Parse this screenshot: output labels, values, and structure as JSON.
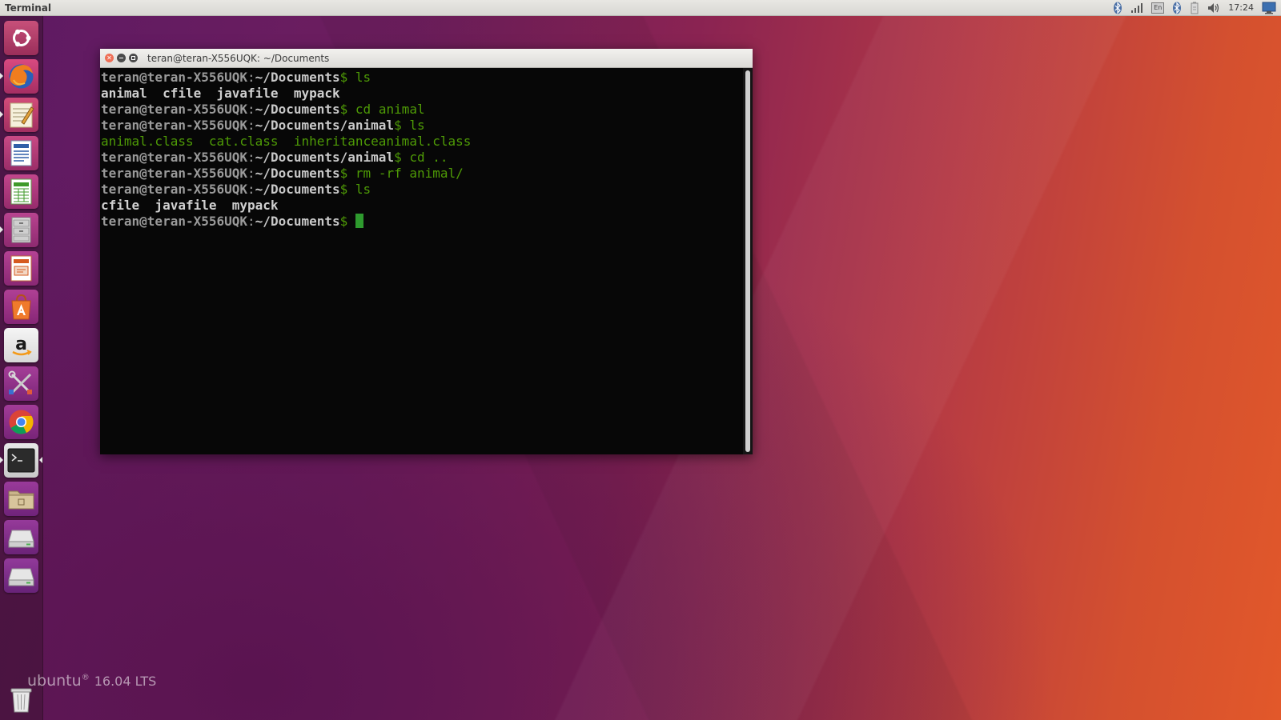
{
  "top_panel": {
    "app_title": "Terminal",
    "keyboard_layout": "En",
    "clock": "17:24",
    "tray_icons": [
      "bluetooth-icon",
      "network-signal-icon",
      "keyboard-layout-icon",
      "bluetooth-icon",
      "battery-icon",
      "volume-icon",
      "clock",
      "system-menu-icon"
    ]
  },
  "launcher": {
    "items": [
      {
        "name": "ubuntu-dash",
        "icon": "ubuntu-logo-icon"
      },
      {
        "name": "firefox",
        "icon": "firefox-icon"
      },
      {
        "name": "text-editor",
        "icon": "text-editor-icon"
      },
      {
        "name": "libreoffice-writer",
        "icon": "writer-document-icon"
      },
      {
        "name": "libreoffice-calc",
        "icon": "calc-spreadsheet-icon"
      },
      {
        "name": "files",
        "icon": "file-cabinet-icon"
      },
      {
        "name": "libreoffice-impress",
        "icon": "impress-presentation-icon"
      },
      {
        "name": "software-center",
        "icon": "shopping-bag-icon"
      },
      {
        "name": "amazon",
        "icon": "amazon-icon"
      },
      {
        "name": "system-settings",
        "icon": "tools-icon"
      },
      {
        "name": "chrome",
        "icon": "chrome-icon"
      },
      {
        "name": "terminal",
        "icon": "terminal-icon"
      },
      {
        "name": "home-folder",
        "icon": "folder-icon"
      },
      {
        "name": "drive-1",
        "icon": "drive-icon"
      },
      {
        "name": "drive-2",
        "icon": "drive-icon"
      },
      {
        "name": "trash",
        "icon": "trash-icon"
      }
    ]
  },
  "branding": {
    "name": "ubuntu",
    "reg": "®",
    "version": "16.04 LTS"
  },
  "terminal": {
    "window_title": "teran@teran-X556UQK: ~/Documents",
    "lines": [
      {
        "user": "teran@teran-X556UQK",
        "colon": ":",
        "path": "~/Documents",
        "dollar": "$",
        "cmd": " ls"
      },
      {
        "out": "animal  cfile  javafile  mypack",
        "style": "plain"
      },
      {
        "user": "teran@teran-X556UQK",
        "colon": ":",
        "path": "~/Documents",
        "dollar": "$",
        "cmd": " cd animal"
      },
      {
        "user": "teran@teran-X556UQK",
        "colon": ":",
        "path": "~/Documents/animal",
        "dollar": "$",
        "cmd": " ls"
      },
      {
        "out": "animal.class  cat.class  inheritanceanimal.class",
        "style": "green"
      },
      {
        "user": "teran@teran-X556UQK",
        "colon": ":",
        "path": "~/Documents/animal",
        "dollar": "$",
        "cmd": " cd .."
      },
      {
        "user": "teran@teran-X556UQK",
        "colon": ":",
        "path": "~/Documents",
        "dollar": "$",
        "cmd": " rm -rf animal/"
      },
      {
        "user": "teran@teran-X556UQK",
        "colon": ":",
        "path": "~/Documents",
        "dollar": "$",
        "cmd": " ls"
      },
      {
        "out": "cfile  javafile  mypack",
        "style": "plain"
      },
      {
        "user": "teran@teran-X556UQK",
        "colon": ":",
        "path": "~/Documents",
        "dollar": "$",
        "cmd": " "
      }
    ]
  },
  "colors": {
    "prompt_green": "#4e9a06",
    "terminal_bg": "#070707",
    "close_button": "#ef6f56"
  }
}
